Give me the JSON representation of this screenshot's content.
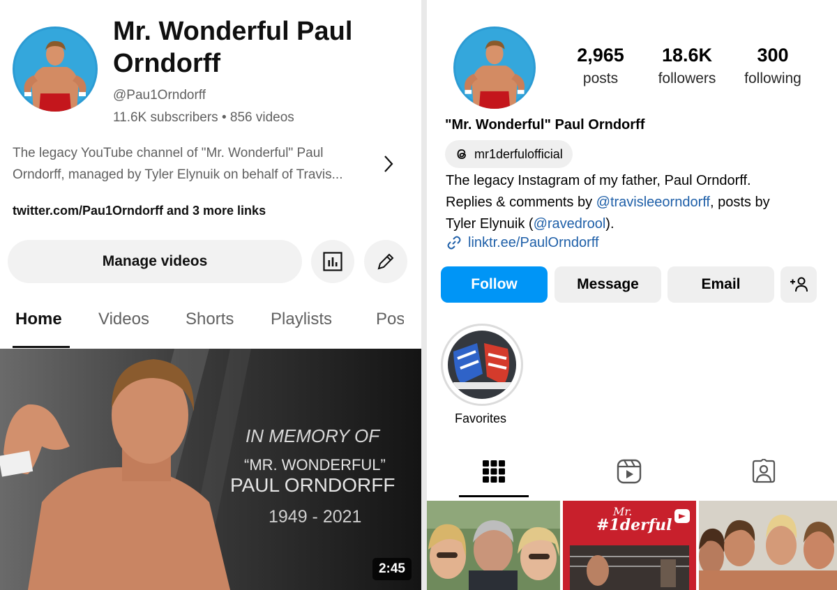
{
  "youtube": {
    "channel_name": "Mr. Wonderful Paul Orndorff",
    "handle": "@Pau1Orndorff",
    "stats": "11.6K subscribers • 856 videos",
    "description": "The legacy YouTube channel of \"Mr. Wonderful\" Paul Orndorff, managed by Tyler Elynuik on behalf of Travis...",
    "links": "twitter.com/Pau1Orndorff and 3 more links",
    "manage_videos_label": "Manage videos",
    "tabs": [
      {
        "label": "Home"
      },
      {
        "label": "Videos"
      },
      {
        "label": "Shorts"
      },
      {
        "label": "Playlists"
      },
      {
        "label": "Pos"
      }
    ],
    "video": {
      "memorial_line1": "IN MEMORY OF",
      "memorial_line2": "“MR. WONDERFUL”",
      "memorial_line3": "PAUL ORNDORFF",
      "memorial_years": "1949 - 2021",
      "duration": "2:45"
    }
  },
  "instagram": {
    "stats": [
      {
        "value": "2,965",
        "label": "posts"
      },
      {
        "value": "18.6K",
        "label": "followers"
      },
      {
        "value": "300",
        "label": "following"
      }
    ],
    "display_name": "\"Mr. Wonderful\" Paul Orndorff",
    "threads_handle": "mr1derfulofficial",
    "bio_line1": "The legacy Instagram of my father, Paul Orndorff.",
    "bio_line2_pre": "Replies & comments by ",
    "bio_mention1": "@travisleeorndorff",
    "bio_line2_post": ", posts by",
    "bio_line3_pre": "Tyler Elynuik (",
    "bio_mention2": "@ravedrool",
    "bio_line3_post": ").",
    "link": "linktr.ee/PaulOrndorff",
    "buttons": {
      "follow": "Follow",
      "message": "Message",
      "email": "Email"
    },
    "highlight_label": "Favorites",
    "thumb2_text_line1": "Mr.",
    "thumb2_text_line2": "#1derful",
    "colors": {
      "follow_blue": "#0095f6",
      "link_blue": "#1e5fa8"
    }
  }
}
